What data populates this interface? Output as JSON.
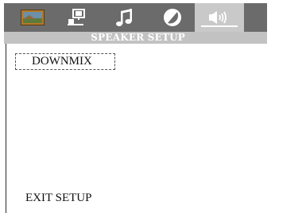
{
  "tabs": [
    {
      "icon": "picture-icon"
    },
    {
      "icon": "display-setup-icon"
    },
    {
      "icon": "music-note-icon"
    },
    {
      "icon": "contrast-icon"
    },
    {
      "icon": "speaker-icon",
      "active": true
    }
  ],
  "header": {
    "title": "SPEAKER SETUP"
  },
  "menu": {
    "items": [
      {
        "label": "DOWNMIX"
      }
    ]
  },
  "footer": {
    "exit_label": "EXIT SETUP"
  }
}
